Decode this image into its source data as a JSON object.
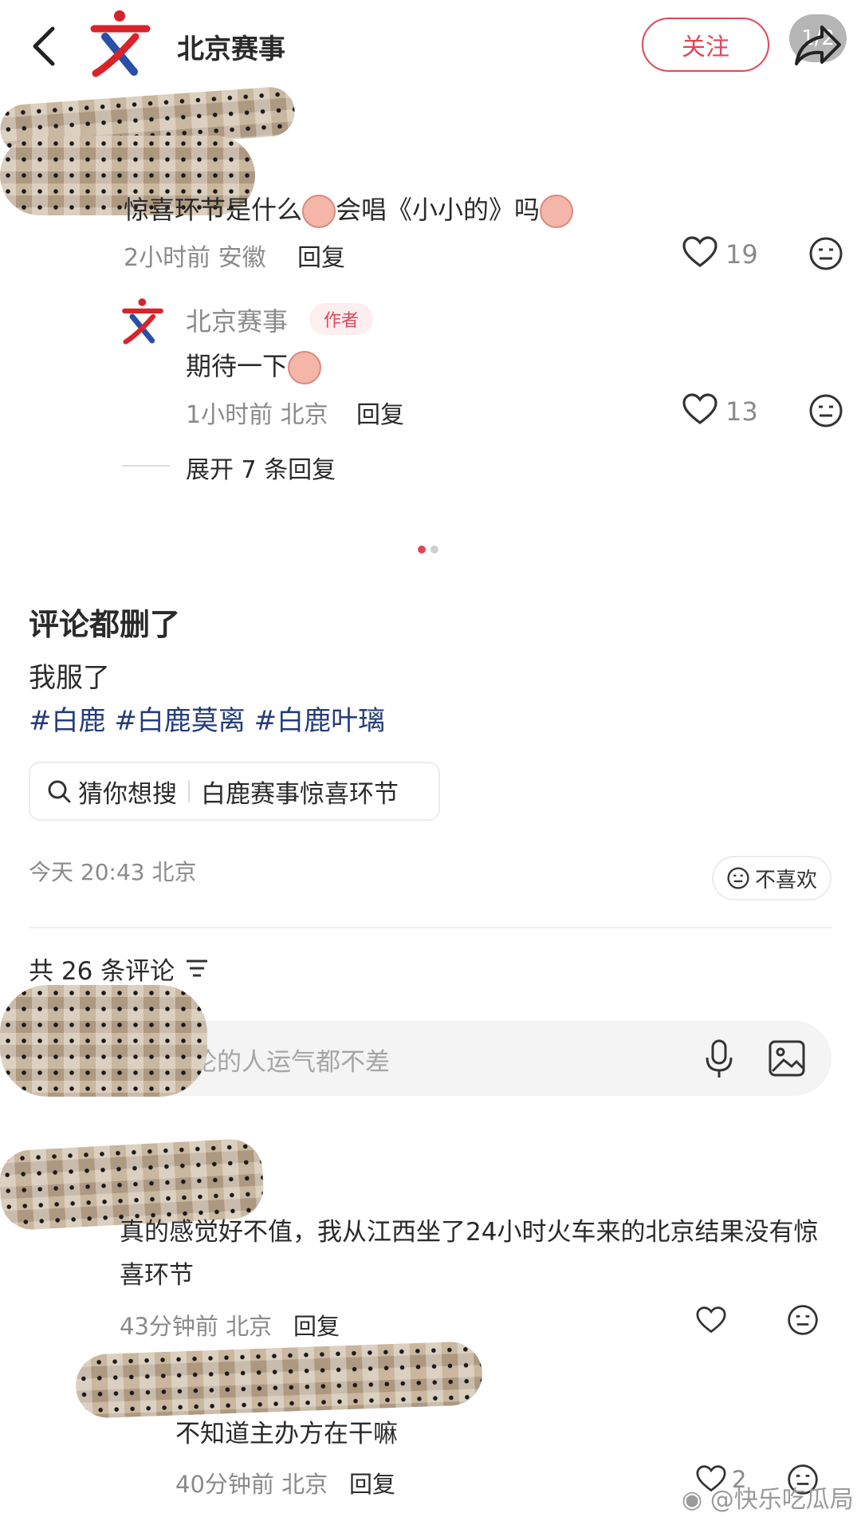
{
  "header": {
    "account_name": "北京赛事",
    "follow_label": "关注",
    "page_indicator": "1/2"
  },
  "top_comment": {
    "text_part1": "惊喜环节是什么",
    "text_part2": "会唱《小小的》吗",
    "time": "2小时前",
    "location": "安徽",
    "reply_label": "回复",
    "likes": "19"
  },
  "author_reply": {
    "name": "北京赛事",
    "tag": "作者",
    "text": "期待一下",
    "time": "1小时前",
    "location": "北京",
    "reply_label": "回复",
    "likes": "13",
    "expand_label": "展开 7 条回复"
  },
  "post": {
    "title": "评论都删了",
    "body": "我服了",
    "hashtags": [
      "#白鹿",
      "#白鹿莫离",
      "#白鹿叶璃"
    ],
    "search_prefix": "猜你想搜",
    "search_term": "白鹿赛事惊喜环节",
    "datetime": "今天 20:43",
    "location": "北京",
    "dislike_label": "不喜欢"
  },
  "comments_section": {
    "count_label": "共 26 条评论",
    "input_placeholder": "评论的人运气都不差"
  },
  "comment1": {
    "text": "真的感觉好不值，我从江西坐了24小时火车来的北京结果没有惊喜环节",
    "time": "43分钟前",
    "location": "北京",
    "reply_label": "回复"
  },
  "comment2": {
    "text": "不知道主办方在干嘛",
    "time": "40分钟前",
    "location": "北京",
    "reply_label": "回复",
    "likes": "2"
  },
  "watermark": "@快乐吃瓜局",
  "colors": {
    "accent": "#e0465a",
    "hashtag": "#243c7a",
    "muted": "#8a8a8a"
  }
}
